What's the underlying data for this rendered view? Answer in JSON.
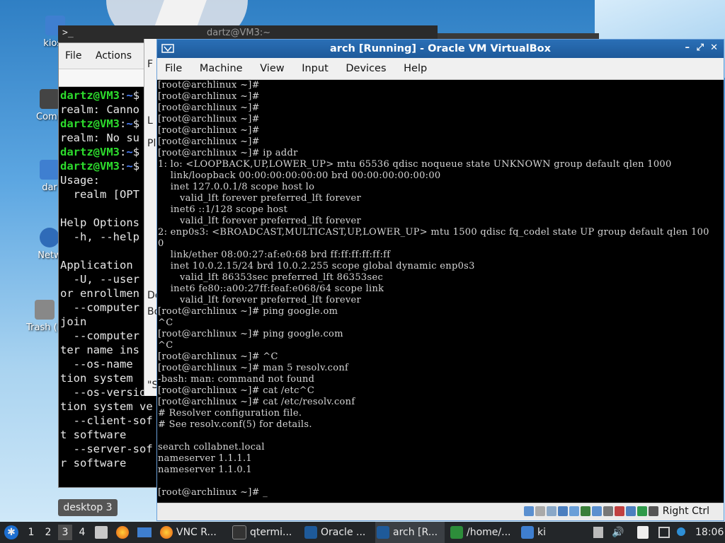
{
  "desktop": {
    "icons": [
      {
        "name": "desktop-icon-home",
        "label": "kiosk"
      },
      {
        "name": "desktop-icon-computer",
        "label": "Comp"
      },
      {
        "name": "desktop-icon-user",
        "label": "dar"
      },
      {
        "name": "desktop-icon-network",
        "label": "Netw"
      },
      {
        "name": "desktop-icon-trash",
        "label": "Trash (E"
      }
    ],
    "label": "desktop 3"
  },
  "qterminal": {
    "title": "dartz@VM3:~",
    "menu": [
      "File",
      "Actions"
    ],
    "lines": [
      {
        "prompt_user": "dartz@VM3",
        "prompt_sep": ":",
        "prompt_path": "~",
        "prompt_end": "$"
      },
      {
        "text": "realm: Canno"
      },
      {
        "prompt_user": "dartz@VM3",
        "prompt_sep": ":",
        "prompt_path": "~",
        "prompt_end": "$"
      },
      {
        "text": "realm: No su"
      },
      {
        "prompt_user": "dartz@VM3",
        "prompt_sep": ":",
        "prompt_path": "~",
        "prompt_end": "$"
      },
      {
        "prompt_user": "dartz@VM3",
        "prompt_sep": ":",
        "prompt_path": "~",
        "prompt_end": "$"
      },
      {
        "text": "Usage:"
      },
      {
        "text": "  realm [OPT"
      },
      {
        "text": ""
      },
      {
        "text": "Help Options"
      },
      {
        "text": "  -h, --help"
      },
      {
        "text": ""
      },
      {
        "text": "Application "
      },
      {
        "text": "  -U, --user"
      },
      {
        "text": "or enrollmen"
      },
      {
        "text": "  --computer"
      },
      {
        "text": "join"
      },
      {
        "text": "  --computer"
      },
      {
        "text": "ter name ins"
      },
      {
        "text": "  --os-name "
      },
      {
        "text": "tion system "
      },
      {
        "text": "  --os-versio"
      },
      {
        "text": "tion system ve"
      },
      {
        "text": "  --client-sof"
      },
      {
        "text": "t software"
      },
      {
        "text": "  --server-sof"
      },
      {
        "text": "r software"
      }
    ]
  },
  "file_manager_fragment": {
    "items": [
      "F",
      "L",
      "Pl",
      "De",
      "Bo",
      "\"S"
    ]
  },
  "virtualbox": {
    "title": "arch [Running] - Oracle VM VirtualBox",
    "window_controls": [
      "–",
      "⤢",
      "✕"
    ],
    "menu": [
      "File",
      "Machine",
      "View",
      "Input",
      "Devices",
      "Help"
    ],
    "console_lines": [
      "[root@archlinux ~]#",
      "[root@archlinux ~]#",
      "[root@archlinux ~]#",
      "[root@archlinux ~]#",
      "[root@archlinux ~]#",
      "[root@archlinux ~]#",
      "[root@archlinux ~]# ip addr",
      "1: lo: <LOOPBACK,UP,LOWER_UP> mtu 65536 qdisc noqueue state UNKNOWN group default qlen 1000",
      "    link/loopback 00:00:00:00:00:00 brd 00:00:00:00:00:00",
      "    inet 127.0.0.1/8 scope host lo",
      "       valid_lft forever preferred_lft forever",
      "    inet6 ::1/128 scope host",
      "       valid_lft forever preferred_lft forever",
      "2: enp0s3: <BROADCAST,MULTICAST,UP,LOWER_UP> mtu 1500 qdisc fq_codel state UP group default qlen 100",
      "0",
      "    link/ether 08:00:27:af:e0:68 brd ff:ff:ff:ff:ff:ff",
      "    inet 10.0.2.15/24 brd 10.0.2.255 scope global dynamic enp0s3",
      "       valid_lft 86353sec preferred_lft 86353sec",
      "    inet6 fe80::a00:27ff:feaf:e068/64 scope link",
      "       valid_lft forever preferred_lft forever",
      "[root@archlinux ~]# ping google.om",
      "^C",
      "[root@archlinux ~]# ping google.com",
      "^C",
      "[root@archlinux ~]# ^C",
      "[root@archlinux ~]# man 5 resolv.conf",
      "-bash: man: command not found",
      "[root@archlinux ~]# cat /etc^C",
      "[root@archlinux ~]# cat /etc/resolv.conf",
      "# Resolver configuration file.",
      "# See resolv.conf(5) for details.",
      "",
      "search collabnet.local",
      "nameserver 1.1.1.1",
      "nameserver 1.1.0.1",
      "",
      "[root@archlinux ~]# _"
    ],
    "status_icons": [
      "hdd-icon",
      "optical-icon",
      "audio-icon",
      "network-icon",
      "usb-icon",
      "shared-folders-icon",
      "display-icon",
      "capture-icon",
      "recording-icon",
      "cpu-icon",
      "mouse-integration-icon",
      "keyboard-icon"
    ],
    "host_key": "Right Ctrl"
  },
  "taskbar": {
    "workspaces": [
      "1",
      "2",
      "3",
      "4"
    ],
    "active_workspace": "3",
    "tasks": [
      {
        "name": "task-vnc",
        "label": "VNC R..."
      },
      {
        "name": "task-qterminal",
        "label": "qtermi..."
      },
      {
        "name": "task-oracle",
        "label": "Oracle ..."
      },
      {
        "name": "task-arch",
        "label": "arch [R..."
      },
      {
        "name": "task-home",
        "label": "/home/..."
      },
      {
        "name": "task-ki",
        "label": "ki"
      }
    ],
    "clock": "18:06"
  },
  "colors": {
    "taskbar_bg": "#232629",
    "vbox_title": "#1e5a9a",
    "prompt_green": "#2ddc2d",
    "prompt_blue": "#4a80ff"
  }
}
